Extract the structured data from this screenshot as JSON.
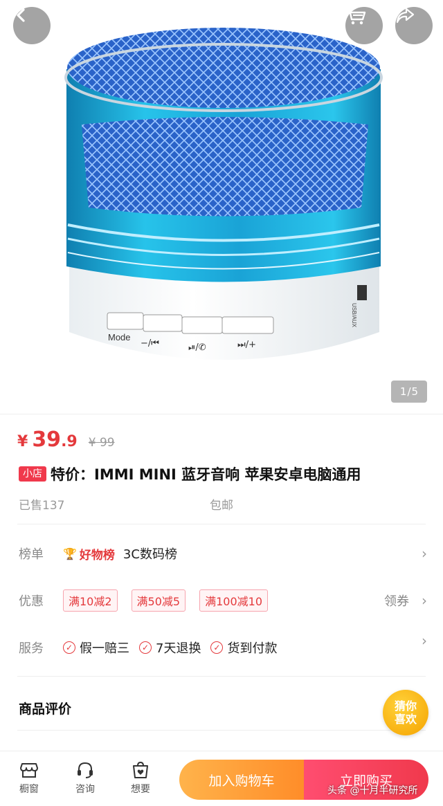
{
  "header": {
    "image_counter_current": "1",
    "image_counter_total": "5",
    "product_labels": {
      "mode": "Mode",
      "prev": "−/⏮",
      "play": "⏯/✆",
      "next": "⏭/+",
      "port": "USB/AUX"
    }
  },
  "price": {
    "currency": "¥",
    "integer": "39",
    "decimal": ".9",
    "original": "¥ 99"
  },
  "product": {
    "shop_tag": "小店",
    "title": "特价：IMMI  MINI 蓝牙音响 苹果安卓电脑通用",
    "sold": "已售137",
    "shipping": "包邮"
  },
  "ranking": {
    "label": "榜单",
    "badge": "好物榜",
    "category": "3C数码榜"
  },
  "promotion": {
    "label": "优惠",
    "coupons": [
      "满10减2",
      "满50减5",
      "满100减10"
    ],
    "get_label": "领券"
  },
  "service": {
    "label": "服务",
    "items": [
      "假一赔三",
      "7天退换",
      "货到付款"
    ]
  },
  "review": {
    "title": "商品评价"
  },
  "guess": {
    "line1": "猜你",
    "line2": "喜欢"
  },
  "bottom_bar": {
    "tabs": [
      "橱窗",
      "咨询",
      "想要"
    ],
    "add_to_cart": "加入购物车",
    "buy_now": "立即购买"
  },
  "watermark": "头条 @十月半研究所",
  "colors": {
    "accent_red": "#e4393c",
    "orange_button": "#ff8d29",
    "pink_button": "#f0394c",
    "speaker_blue": "#1fa7d8"
  }
}
